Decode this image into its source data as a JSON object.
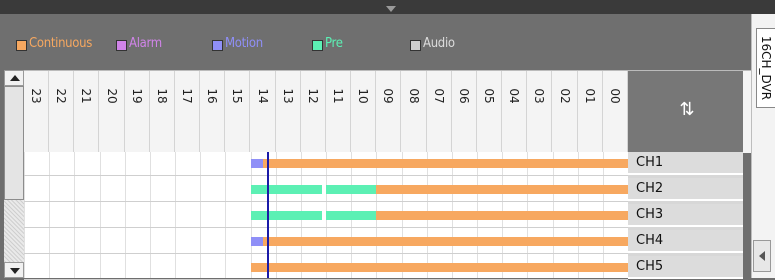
{
  "legend": [
    {
      "label": "Continuous",
      "color": "#f7a860",
      "swatch": "#f7a860"
    },
    {
      "label": "Alarm",
      "color": "#d084e8",
      "swatch": "#d084e8"
    },
    {
      "label": "Motion",
      "color": "#8f8ff7",
      "swatch": "#8f8ff7"
    },
    {
      "label": "Pre",
      "color": "#5cf0b4",
      "swatch": "#5cf0b4"
    },
    {
      "label": "Audio",
      "color": "#dcdcdc",
      "swatch": "#cfcfcf"
    }
  ],
  "device_title": "16CH_DVR",
  "hours": [
    "23",
    "22",
    "21",
    "20",
    "19",
    "18",
    "17",
    "16",
    "15",
    "14",
    "13",
    "12",
    "11",
    "10",
    "09",
    "08",
    "07",
    "06",
    "05",
    "04",
    "03",
    "02",
    "01",
    "00"
  ],
  "channels": [
    {
      "label": "CH1",
      "segments": [
        {
          "type": "motion",
          "start": "14:30",
          "end": "15:00"
        },
        {
          "type": "continuous",
          "start": "00:00",
          "end": "14:30"
        }
      ]
    },
    {
      "label": "CH2",
      "segments": [
        {
          "type": "pre",
          "start": "10:00",
          "end": "12:00"
        },
        {
          "type": "pre",
          "start": "12:10",
          "end": "15:00"
        },
        {
          "type": "continuous",
          "start": "00:00",
          "end": "10:00"
        }
      ]
    },
    {
      "label": "CH3",
      "segments": [
        {
          "type": "pre",
          "start": "10:00",
          "end": "12:00"
        },
        {
          "type": "pre",
          "start": "12:10",
          "end": "15:00"
        },
        {
          "type": "continuous",
          "start": "00:00",
          "end": "10:00"
        }
      ]
    },
    {
      "label": "CH4",
      "segments": [
        {
          "type": "motion",
          "start": "14:30",
          "end": "15:00"
        },
        {
          "type": "continuous",
          "start": "00:00",
          "end": "14:30"
        }
      ]
    },
    {
      "label": "CH5",
      "segments": [
        {
          "type": "continuous",
          "start": "00:00",
          "end": "15:00"
        }
      ]
    }
  ],
  "playback_marker_time": "14:20",
  "icons": {
    "refresh": "refresh-icon",
    "scroll_up": "arrow-up-icon",
    "scroll_down": "arrow-down-icon",
    "side_scroll": "arrow-left-icon"
  }
}
